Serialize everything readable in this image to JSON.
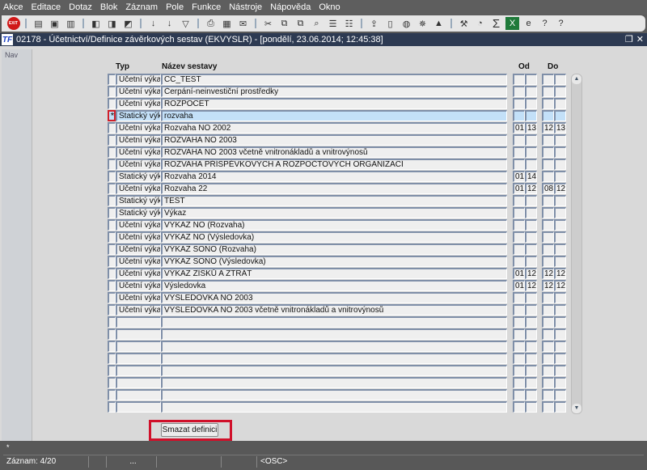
{
  "menu": [
    "Akce",
    "Editace",
    "Dotaz",
    "Blok",
    "Záznam",
    "Pole",
    "Funkce",
    "Nástroje",
    "Nápověda",
    "Okno"
  ],
  "toolbar": {
    "icons": [
      "exit-icon",
      "|",
      "insert-record-icon",
      "save-icon",
      "delete-icon",
      "|",
      "enter-query-icon",
      "execute-query-icon",
      "cancel-query-icon",
      "|",
      "sort-asc-icon",
      "sort-desc-icon",
      "filter-icon",
      "|",
      "print-icon",
      "print-setup-icon",
      "mail-icon",
      "|",
      "cut-icon",
      "copy-icon",
      "paste-icon",
      "search-icon",
      "list-icon",
      "columns-icon",
      "|",
      "export-icon",
      "document-icon",
      "globe-icon",
      "wheel-icon",
      "mountain-icon",
      "|",
      "tools-icon",
      "chart-icon",
      "sum-icon",
      "excel-icon",
      "ie-icon",
      "help-icon",
      "about-icon"
    ],
    "exit_label": "EXIT"
  },
  "window": {
    "title": "02178 - Účetnictví/Definice závěrkových sestav (EKVYSLR) - [pondělí, 23.06.2014; 12:45:38]",
    "logo": "TF"
  },
  "nav": {
    "label": "Nav"
  },
  "table": {
    "headers": {
      "typ": "Typ",
      "nazev": "Název sestavy",
      "od": "Od",
      "do": "Do"
    },
    "current_marker": "*",
    "selected_index": 3,
    "rows": [
      {
        "typ": "Účetní výkaz",
        "nazev": "CC_TEST",
        "od1": "",
        "od2": "",
        "do1": "",
        "do2": ""
      },
      {
        "typ": "Účetní výkaz",
        "nazev": "Čerpání-neinvestiční prostředky",
        "od1": "",
        "od2": "",
        "do1": "",
        "do2": ""
      },
      {
        "typ": "Účetní výkaz",
        "nazev": "ROZPOCET",
        "od1": "",
        "od2": "",
        "do1": "",
        "do2": ""
      },
      {
        "typ": "Statický výkaz",
        "nazev": "rozvaha",
        "od1": "",
        "od2": "",
        "do1": "",
        "do2": ""
      },
      {
        "typ": "Účetní výkaz",
        "nazev": "Rozvaha NO 2002",
        "od1": "01",
        "od2": "13",
        "do1": "12",
        "do2": "13"
      },
      {
        "typ": "Účetní výkaz",
        "nazev": "ROZVAHA NO 2003",
        "od1": "",
        "od2": "",
        "do1": "",
        "do2": ""
      },
      {
        "typ": "Účetní výkaz",
        "nazev": "ROZVAHA NO 2003 včetně vnitronákladů a vnitrovýnosů",
        "od1": "",
        "od2": "",
        "do1": "",
        "do2": ""
      },
      {
        "typ": "Účetní výkaz",
        "nazev": "ROZVAHA PŘÍSPĚVKOVÝCH A ROZPOČTOVÝCH ORGANIZACÍ",
        "od1": "",
        "od2": "",
        "do1": "",
        "do2": ""
      },
      {
        "typ": "Statický výkaz",
        "nazev": "Rozvaha 2014",
        "od1": "01",
        "od2": "14",
        "do1": "",
        "do2": ""
      },
      {
        "typ": "Účetní výkaz",
        "nazev": "Rozvaha 22",
        "od1": "01",
        "od2": "12",
        "do1": "08",
        "do2": "12"
      },
      {
        "typ": "Statický výkaz",
        "nazev": "TEST",
        "od1": "",
        "od2": "",
        "do1": "",
        "do2": ""
      },
      {
        "typ": "Statický výkaz",
        "nazev": "Výkaz",
        "od1": "",
        "od2": "",
        "do1": "",
        "do2": ""
      },
      {
        "typ": "Účetní výkaz",
        "nazev": "VÝKAZ NO (Rozvaha)",
        "od1": "",
        "od2": "",
        "do1": "",
        "do2": ""
      },
      {
        "typ": "Účetní výkaz",
        "nazev": "VÝKAZ NO (Výsledovka)",
        "od1": "",
        "od2": "",
        "do1": "",
        "do2": ""
      },
      {
        "typ": "Účetní výkaz",
        "nazev": "VÝKAZ SONO (Rozvaha)",
        "od1": "",
        "od2": "",
        "do1": "",
        "do2": ""
      },
      {
        "typ": "Účetní výkaz",
        "nazev": "VÝKAZ SONO (Výsledovka)",
        "od1": "",
        "od2": "",
        "do1": "",
        "do2": ""
      },
      {
        "typ": "Účetní výkaz",
        "nazev": "VÝKAZ ZISKŮ A ZTRÁT",
        "od1": "01",
        "od2": "12",
        "do1": "12",
        "do2": "12"
      },
      {
        "typ": "Účetní výkaz",
        "nazev": "Výsledovka",
        "od1": "01",
        "od2": "12",
        "do1": "12",
        "do2": "12"
      },
      {
        "typ": "Účetní výkaz",
        "nazev": "VÝSLEDOVKA NO 2003",
        "od1": "",
        "od2": "",
        "do1": "",
        "do2": ""
      },
      {
        "typ": "Účetní výkaz",
        "nazev": "VÝSLEDOVKA NO 2003 včetně vnitronákladů a vnitrovýnosů",
        "od1": "",
        "od2": "",
        "do1": "",
        "do2": ""
      }
    ],
    "total_visible_rows": 28
  },
  "button": {
    "label": "Smazat definici"
  },
  "status": {
    "message": "*",
    "record": "Záznam: 4/20",
    "dots": "...",
    "mode": "<OSC>"
  }
}
